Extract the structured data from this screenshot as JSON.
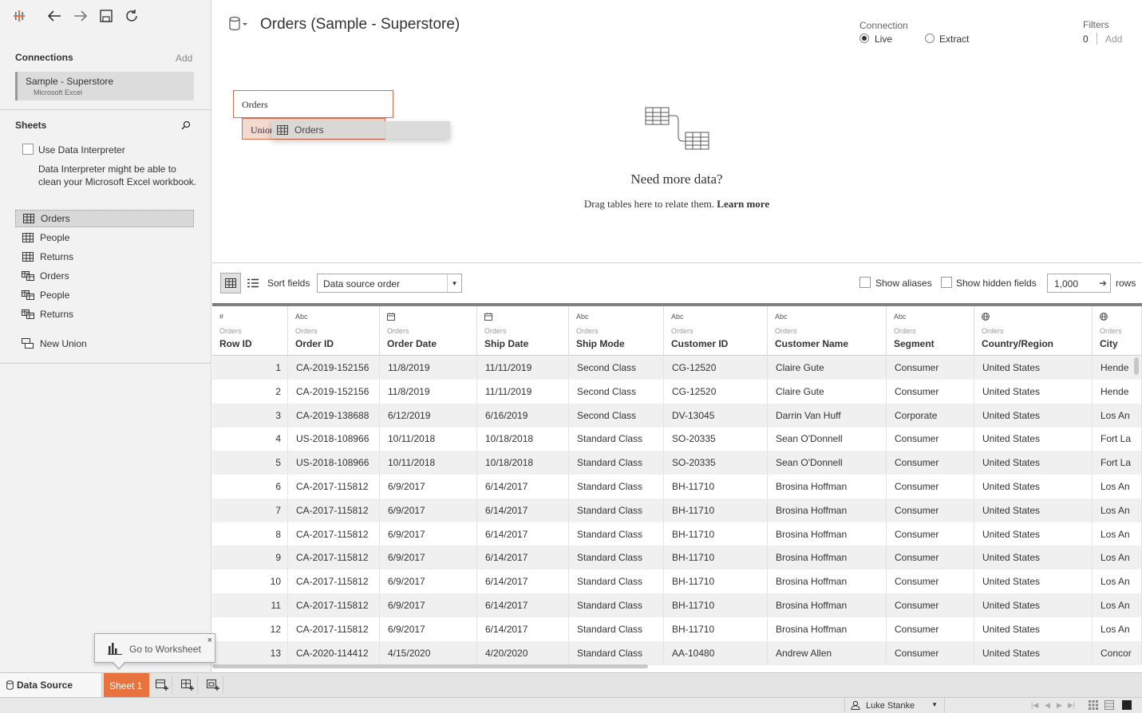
{
  "toolbar": {
    "icons": [
      "tableau-logo-icon",
      "back-arrow-icon",
      "forward-arrow-icon",
      "save-icon",
      "refresh-icon"
    ]
  },
  "connections": {
    "title": "Connections",
    "add_label": "Add",
    "item_name": "Sample - Superstore",
    "item_type": "Microsoft Excel"
  },
  "sheets": {
    "title": "Sheets",
    "search_icon": "search-icon",
    "interpreter_label": "Use Data Interpreter",
    "interpreter_desc": "Data Interpreter might be able to clean your Microsoft Excel workbook.",
    "items": [
      {
        "label": "Orders",
        "icon": "table-icon"
      },
      {
        "label": "People",
        "icon": "table-icon"
      },
      {
        "label": "Returns",
        "icon": "table-icon"
      },
      {
        "label": "Orders",
        "icon": "named-range-icon"
      },
      {
        "label": "People",
        "icon": "named-range-icon"
      },
      {
        "label": "Returns",
        "icon": "named-range-icon"
      }
    ],
    "new_union": "New Union"
  },
  "datasource": {
    "title": "Orders (Sample - Superstore)",
    "connection_label": "Connection",
    "live_label": "Live",
    "extract_label": "Extract",
    "selected_connection": "Live",
    "filters_label": "Filters",
    "filters_count": "0",
    "filters_add": "Add"
  },
  "canvas": {
    "orders_table": "Orders",
    "union_label": "Union",
    "drag_item": "Orders",
    "need_more": "Need more data?",
    "drag_text": "Drag tables here to relate them.",
    "learn_more": "Learn more"
  },
  "grid_toolbar": {
    "sort_label": "Sort fields",
    "sort_value": "Data source order",
    "show_aliases": "Show aliases",
    "show_hidden": "Show hidden fields",
    "rows_value": "1,000",
    "rows_label": "rows"
  },
  "table": {
    "columns": [
      {
        "type": "#",
        "source": "Orders",
        "name": "Row ID"
      },
      {
        "type": "Abc",
        "source": "Orders",
        "name": "Order ID"
      },
      {
        "type": "calendar-icon",
        "source": "Orders",
        "name": "Order Date"
      },
      {
        "type": "calendar-icon",
        "source": "Orders",
        "name": "Ship Date"
      },
      {
        "type": "Abc",
        "source": "Orders",
        "name": "Ship Mode"
      },
      {
        "type": "Abc",
        "source": "Orders",
        "name": "Customer ID"
      },
      {
        "type": "Abc",
        "source": "Orders",
        "name": "Customer Name"
      },
      {
        "type": "Abc",
        "source": "Orders",
        "name": "Segment"
      },
      {
        "type": "globe-icon",
        "source": "Orders",
        "name": "Country/Region"
      },
      {
        "type": "globe-icon",
        "source": "Orders",
        "name": "City"
      }
    ],
    "rows": [
      [
        "1",
        "CA-2019-152156",
        "11/8/2019",
        "11/11/2019",
        "Second Class",
        "CG-12520",
        "Claire Gute",
        "Consumer",
        "United States",
        "Hende"
      ],
      [
        "2",
        "CA-2019-152156",
        "11/8/2019",
        "11/11/2019",
        "Second Class",
        "CG-12520",
        "Claire Gute",
        "Consumer",
        "United States",
        "Hende"
      ],
      [
        "3",
        "CA-2019-138688",
        "6/12/2019",
        "6/16/2019",
        "Second Class",
        "DV-13045",
        "Darrin Van Huff",
        "Corporate",
        "United States",
        "Los An"
      ],
      [
        "4",
        "US-2018-108966",
        "10/11/2018",
        "10/18/2018",
        "Standard Class",
        "SO-20335",
        "Sean O'Donnell",
        "Consumer",
        "United States",
        "Fort La"
      ],
      [
        "5",
        "US-2018-108966",
        "10/11/2018",
        "10/18/2018",
        "Standard Class",
        "SO-20335",
        "Sean O'Donnell",
        "Consumer",
        "United States",
        "Fort La"
      ],
      [
        "6",
        "CA-2017-115812",
        "6/9/2017",
        "6/14/2017",
        "Standard Class",
        "BH-11710",
        "Brosina Hoffman",
        "Consumer",
        "United States",
        "Los An"
      ],
      [
        "7",
        "CA-2017-115812",
        "6/9/2017",
        "6/14/2017",
        "Standard Class",
        "BH-11710",
        "Brosina Hoffman",
        "Consumer",
        "United States",
        "Los An"
      ],
      [
        "8",
        "CA-2017-115812",
        "6/9/2017",
        "6/14/2017",
        "Standard Class",
        "BH-11710",
        "Brosina Hoffman",
        "Consumer",
        "United States",
        "Los An"
      ],
      [
        "9",
        "CA-2017-115812",
        "6/9/2017",
        "6/14/2017",
        "Standard Class",
        "BH-11710",
        "Brosina Hoffman",
        "Consumer",
        "United States",
        "Los An"
      ],
      [
        "10",
        "CA-2017-115812",
        "6/9/2017",
        "6/14/2017",
        "Standard Class",
        "BH-11710",
        "Brosina Hoffman",
        "Consumer",
        "United States",
        "Los An"
      ],
      [
        "11",
        "CA-2017-115812",
        "6/9/2017",
        "6/14/2017",
        "Standard Class",
        "BH-11710",
        "Brosina Hoffman",
        "Consumer",
        "United States",
        "Los An"
      ],
      [
        "12",
        "CA-2017-115812",
        "6/9/2017",
        "6/14/2017",
        "Standard Class",
        "BH-11710",
        "Brosina Hoffman",
        "Consumer",
        "United States",
        "Los An"
      ],
      [
        "13",
        "CA-2020-114412",
        "4/15/2020",
        "4/20/2020",
        "Standard Class",
        "AA-10480",
        "Andrew Allen",
        "Consumer",
        "United States",
        "Concor"
      ]
    ]
  },
  "tooltip": {
    "label": "Go to Worksheet",
    "close": "×"
  },
  "tabs": {
    "data_source": "Data Source",
    "sheet1": "Sheet 1"
  },
  "status": {
    "user": "Luke Stanke"
  },
  "colors": {
    "accent": "#e8733f",
    "join_border": "#d76b50"
  }
}
